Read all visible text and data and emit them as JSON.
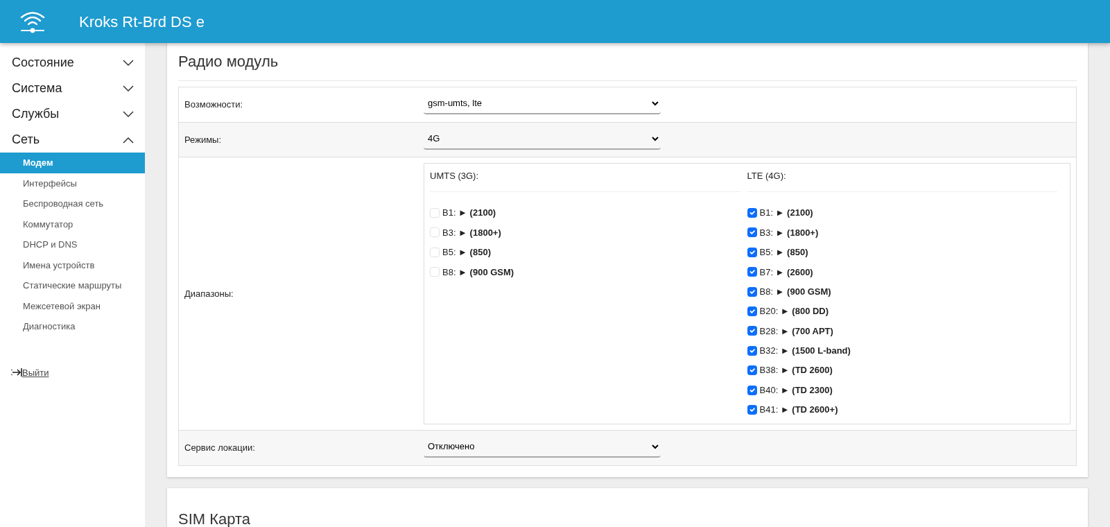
{
  "header": {
    "title": "Kroks Rt-Brd DS e"
  },
  "sidebar": {
    "groups": [
      {
        "label": "Состояние",
        "expanded": false
      },
      {
        "label": "Система",
        "expanded": false
      },
      {
        "label": "Службы",
        "expanded": false
      },
      {
        "label": "Сеть",
        "expanded": true,
        "children": [
          {
            "label": "Модем",
            "selected": true
          },
          {
            "label": "Интерфейсы",
            "selected": false
          },
          {
            "label": "Беспроводная сеть",
            "selected": false
          },
          {
            "label": "Коммутатор",
            "selected": false
          },
          {
            "label": "DHCP и DNS",
            "selected": false
          },
          {
            "label": "Имена устройств",
            "selected": false
          },
          {
            "label": "Статические маршруты",
            "selected": false
          },
          {
            "label": "Межсетевой экран",
            "selected": false
          },
          {
            "label": "Диагностика",
            "selected": false
          }
        ]
      }
    ],
    "logout": {
      "label": "Выйти"
    }
  },
  "sections": [
    {
      "title": "Радио модуль",
      "rows": [
        {
          "kind": "select",
          "label": "Возможности:",
          "value": "gsm-umts, lte"
        },
        {
          "kind": "select",
          "label": "Режимы:",
          "value": "4G"
        },
        {
          "kind": "bands",
          "label": "Диапазоны:",
          "columns": [
            {
              "title": "UMTS (3G):",
              "bands": [
                {
                  "text": "B1: ► **(2100)**",
                  "checked": false
                },
                {
                  "text": "B3: ► **(1800+)**",
                  "checked": false
                },
                {
                  "text": "B5: ► **(850)**",
                  "checked": false
                },
                {
                  "text": "B8: ► **(900 GSM)**",
                  "checked": false
                }
              ]
            },
            {
              "title": "LTE (4G):",
              "bands": [
                {
                  "text": "B1: ► **(2100)**",
                  "checked": true
                },
                {
                  "text": "B3: ► **(1800+)**",
                  "checked": true
                },
                {
                  "text": "B5: ► **(850)**",
                  "checked": true
                },
                {
                  "text": "B7: ► **(2600)**",
                  "checked": true
                },
                {
                  "text": "B8: ► **(900 GSM)**",
                  "checked": true
                },
                {
                  "text": "B20: ► **(800 DD)**",
                  "checked": true
                },
                {
                  "text": "B28: ► **(700 APT)**",
                  "checked": true
                },
                {
                  "text": "B32: ► **(1500 L-band)**",
                  "checked": true
                },
                {
                  "text": "B38: ► **(TD 2600)**",
                  "checked": true
                },
                {
                  "text": "B40: ► **(TD 2300)**",
                  "checked": true
                },
                {
                  "text": "B41: ► **(TD 2600+)**",
                  "checked": true
                }
              ]
            }
          ]
        },
        {
          "kind": "select",
          "label": "Сервис локации:",
          "value": "Отключено"
        }
      ]
    },
    {
      "title": "SIM Карта"
    }
  ]
}
